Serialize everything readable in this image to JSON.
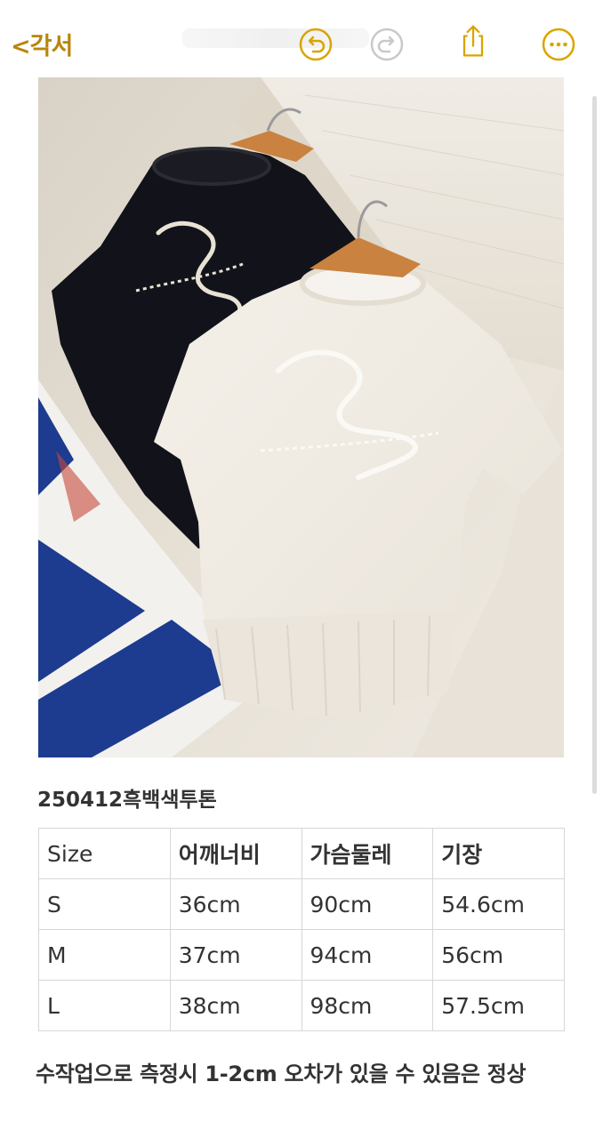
{
  "topbar": {
    "back_label": "<각서",
    "icons": [
      "undo-icon",
      "redo-icon",
      "share-icon",
      "more-icon"
    ],
    "accent_color": "#d9a400"
  },
  "product": {
    "title": "250412흑백색투톤"
  },
  "size_table": {
    "headers": [
      "Size",
      "어깨너비",
      "가슴둘레",
      "기장"
    ],
    "rows": [
      [
        "S",
        "36cm",
        "90cm",
        "54.6cm"
      ],
      [
        "M",
        "37cm",
        "94cm",
        "56cm"
      ],
      [
        "L",
        "38cm",
        "98cm",
        "57.5cm"
      ]
    ]
  },
  "note": "수작업으로 측정시 1-2cm 오차가 있을 수 있음은 정상"
}
